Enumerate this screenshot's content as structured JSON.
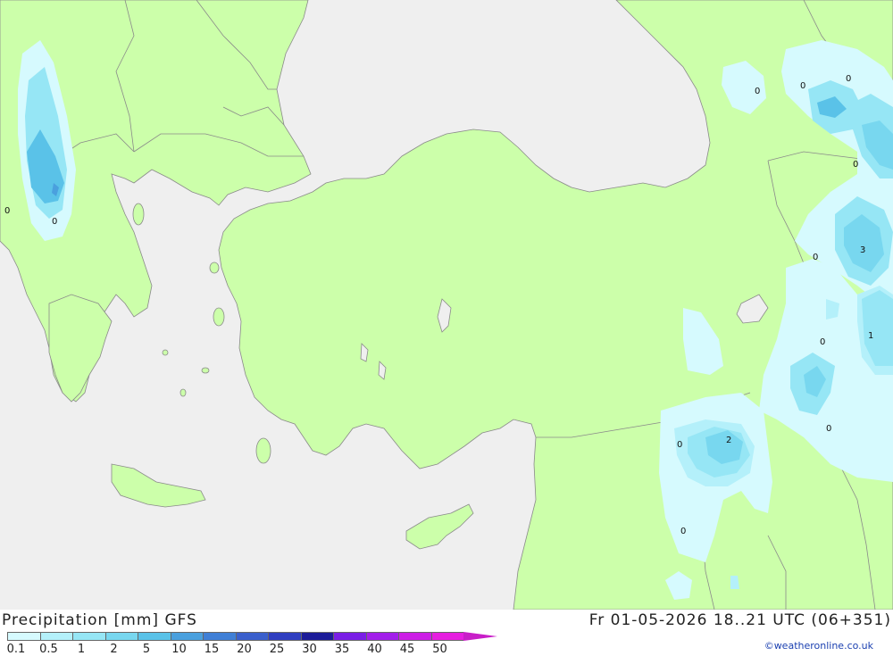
{
  "header": {
    "title": "Precipitation [mm] GFS",
    "run": "Fr 01-05-2026 18..21 UTC (06+351)",
    "credit": "©weatheronline.co.uk"
  },
  "legend": {
    "ticks": [
      "0.1",
      "0.5",
      "1",
      "2",
      "5",
      "10",
      "15",
      "20",
      "25",
      "30",
      "35",
      "40",
      "45",
      "50"
    ],
    "colors": [
      "#d6fafe",
      "#b4f0fa",
      "#96e6f5",
      "#78d7ef",
      "#5ac2e8",
      "#4aa0de",
      "#3f7fd6",
      "#3a5fcc",
      "#2f3ec0",
      "#1c1c99",
      "#7a1ee6",
      "#a21eea",
      "#cc1ee6",
      "#e61ee0",
      "#c81ec8"
    ]
  },
  "map_labels": [
    "0",
    "0",
    "0",
    "0",
    "0",
    "0",
    "0",
    "0",
    "0",
    "0",
    "0",
    "3",
    "1",
    "2"
  ],
  "colors": {
    "land": "#ccffaa",
    "sea": "#efefef",
    "border": "#888888"
  }
}
